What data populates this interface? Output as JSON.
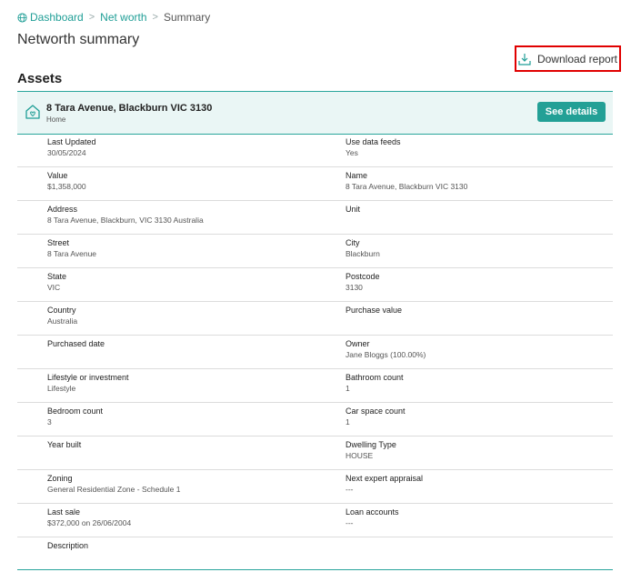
{
  "breadcrumb": {
    "home": "Dashboard",
    "networth": "Net worth",
    "current": "Summary",
    "sep": ">"
  },
  "page": {
    "title": "Networth summary",
    "download_label": "Download report"
  },
  "assets": {
    "heading": "Assets",
    "card": {
      "name": "8 Tara Avenue, Blackburn VIC 3130",
      "type": "Home",
      "details_label": "See details"
    },
    "rows": [
      {
        "left": {
          "label": "Last Updated",
          "value": "30/05/2024"
        },
        "right": {
          "label": "Use data feeds",
          "value": "Yes"
        }
      },
      {
        "left": {
          "label": "Value",
          "value": "$1,358,000"
        },
        "right": {
          "label": "Name",
          "value": "8 Tara Avenue, Blackburn VIC 3130"
        }
      },
      {
        "left": {
          "label": "Address",
          "value": "8 Tara Avenue, Blackburn, VIC 3130 Australia"
        },
        "right": {
          "label": "Unit",
          "value": ""
        }
      },
      {
        "left": {
          "label": "Street",
          "value": "8 Tara Avenue"
        },
        "right": {
          "label": "City",
          "value": "Blackburn"
        }
      },
      {
        "left": {
          "label": "State",
          "value": "VIC"
        },
        "right": {
          "label": "Postcode",
          "value": "3130"
        }
      },
      {
        "left": {
          "label": "Country",
          "value": "Australia"
        },
        "right": {
          "label": "Purchase value",
          "value": ""
        }
      },
      {
        "left": {
          "label": "Purchased date",
          "value": ""
        },
        "right": {
          "label": "Owner",
          "value": "Jane Bloggs (100.00%)"
        }
      },
      {
        "left": {
          "label": "Lifestyle or investment",
          "value": "Lifestyle"
        },
        "right": {
          "label": "Bathroom count",
          "value": "1"
        }
      },
      {
        "left": {
          "label": "Bedroom count",
          "value": "3"
        },
        "right": {
          "label": "Car space count",
          "value": "1"
        }
      },
      {
        "left": {
          "label": "Year built",
          "value": ""
        },
        "right": {
          "label": "Dwelling Type",
          "value": "HOUSE"
        }
      },
      {
        "left": {
          "label": "Zoning",
          "value": "General Residential Zone - Schedule 1"
        },
        "right": {
          "label": "Next expert appraisal",
          "value": "---"
        }
      },
      {
        "left": {
          "label": "Last sale",
          "value": "$372,000 on 26/06/2004"
        },
        "right": {
          "label": "Loan accounts",
          "value": "---"
        }
      },
      {
        "left": {
          "label": "Description",
          "value": ""
        },
        "right": {
          "label": "",
          "value": ""
        }
      }
    ]
  }
}
